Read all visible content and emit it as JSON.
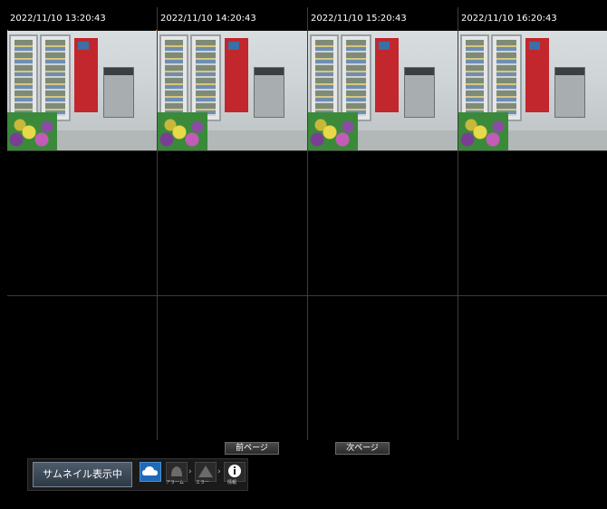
{
  "cameras": [
    {
      "timestamp": "2022/11/10 13:20:43",
      "selected": true
    },
    {
      "timestamp": "2022/11/10 14:20:43",
      "selected": false
    },
    {
      "timestamp": "2022/11/10 15:20:43",
      "selected": false
    },
    {
      "timestamp": "2022/11/10 16:20:43",
      "selected": false
    }
  ],
  "paging": {
    "prev_label": "前ページ",
    "next_label": "次ページ"
  },
  "status_bar": {
    "mode_label": "サムネイル表示中",
    "icons": [
      {
        "name": "weather-cloud-icon",
        "label": ""
      },
      {
        "name": "alarm-bell-icon",
        "label": "アラーム"
      },
      {
        "name": "error-triangle-icon",
        "label": "エラー"
      },
      {
        "name": "info-icon",
        "label": "情報"
      }
    ]
  },
  "colors": {
    "selection_outline": "#d0863a",
    "active_icon_bg": "#1e6ab8"
  }
}
